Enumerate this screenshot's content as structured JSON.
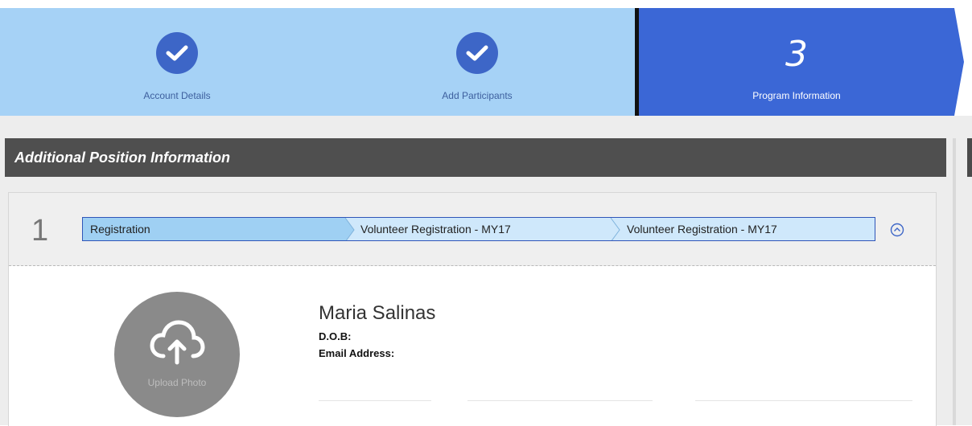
{
  "stepper": {
    "steps": [
      {
        "label": "Account Details",
        "state": "complete",
        "icon": "check-circle-icon"
      },
      {
        "label": "Add Participants",
        "state": "complete",
        "icon": "check-circle-icon"
      },
      {
        "label": "Program Information",
        "number": "3",
        "state": "active"
      }
    ],
    "colors": {
      "complete": "#a6d2f6",
      "active": "#3b67d6",
      "icon": "#3d66c7"
    }
  },
  "section": {
    "title": "Additional Position Information"
  },
  "registration": {
    "index": "1",
    "breadcrumb": [
      "Registration",
      "Volunteer Registration - MY17",
      "Volunteer Registration - MY17"
    ],
    "collapse_icon": "chevron-up-circle-icon"
  },
  "participant": {
    "name": "Maria Salinas",
    "dob_label": "D.O.B:",
    "dob_value": "",
    "email_label": "Email Address:",
    "email_value": "",
    "upload_label": "Upload Photo",
    "upload_icon": "cloud-upload-icon"
  }
}
